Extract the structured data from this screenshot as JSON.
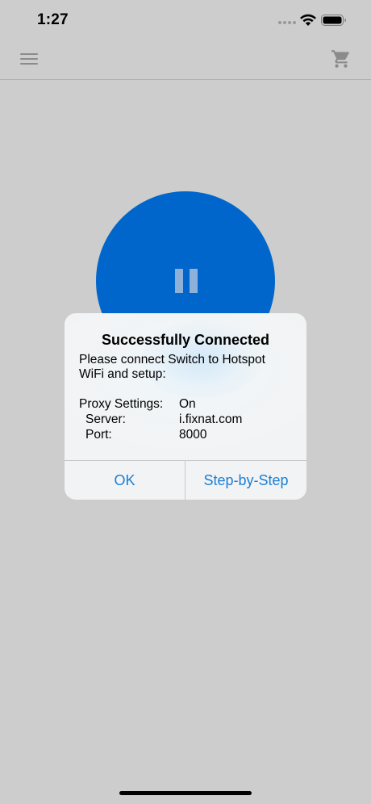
{
  "status_bar": {
    "time": "1:27"
  },
  "nav": {
    "menu_icon": "hamburger-menu-icon",
    "cart_icon": "shopping-cart-icon"
  },
  "main": {
    "toggle_icon": "pause-icon",
    "toggle_color": "#0066cc"
  },
  "alert": {
    "title": "Successfully Connected",
    "message": "Please connect Switch to Hotspot WiFi and setup:",
    "proxy_label": "Proxy Settings:",
    "proxy_value": "On",
    "server_label": "Server:",
    "server_value": "i.fixnat.com",
    "port_label": "Port:",
    "port_value": "8000",
    "ok_label": "OK",
    "step_label": "Step-by-Step"
  }
}
